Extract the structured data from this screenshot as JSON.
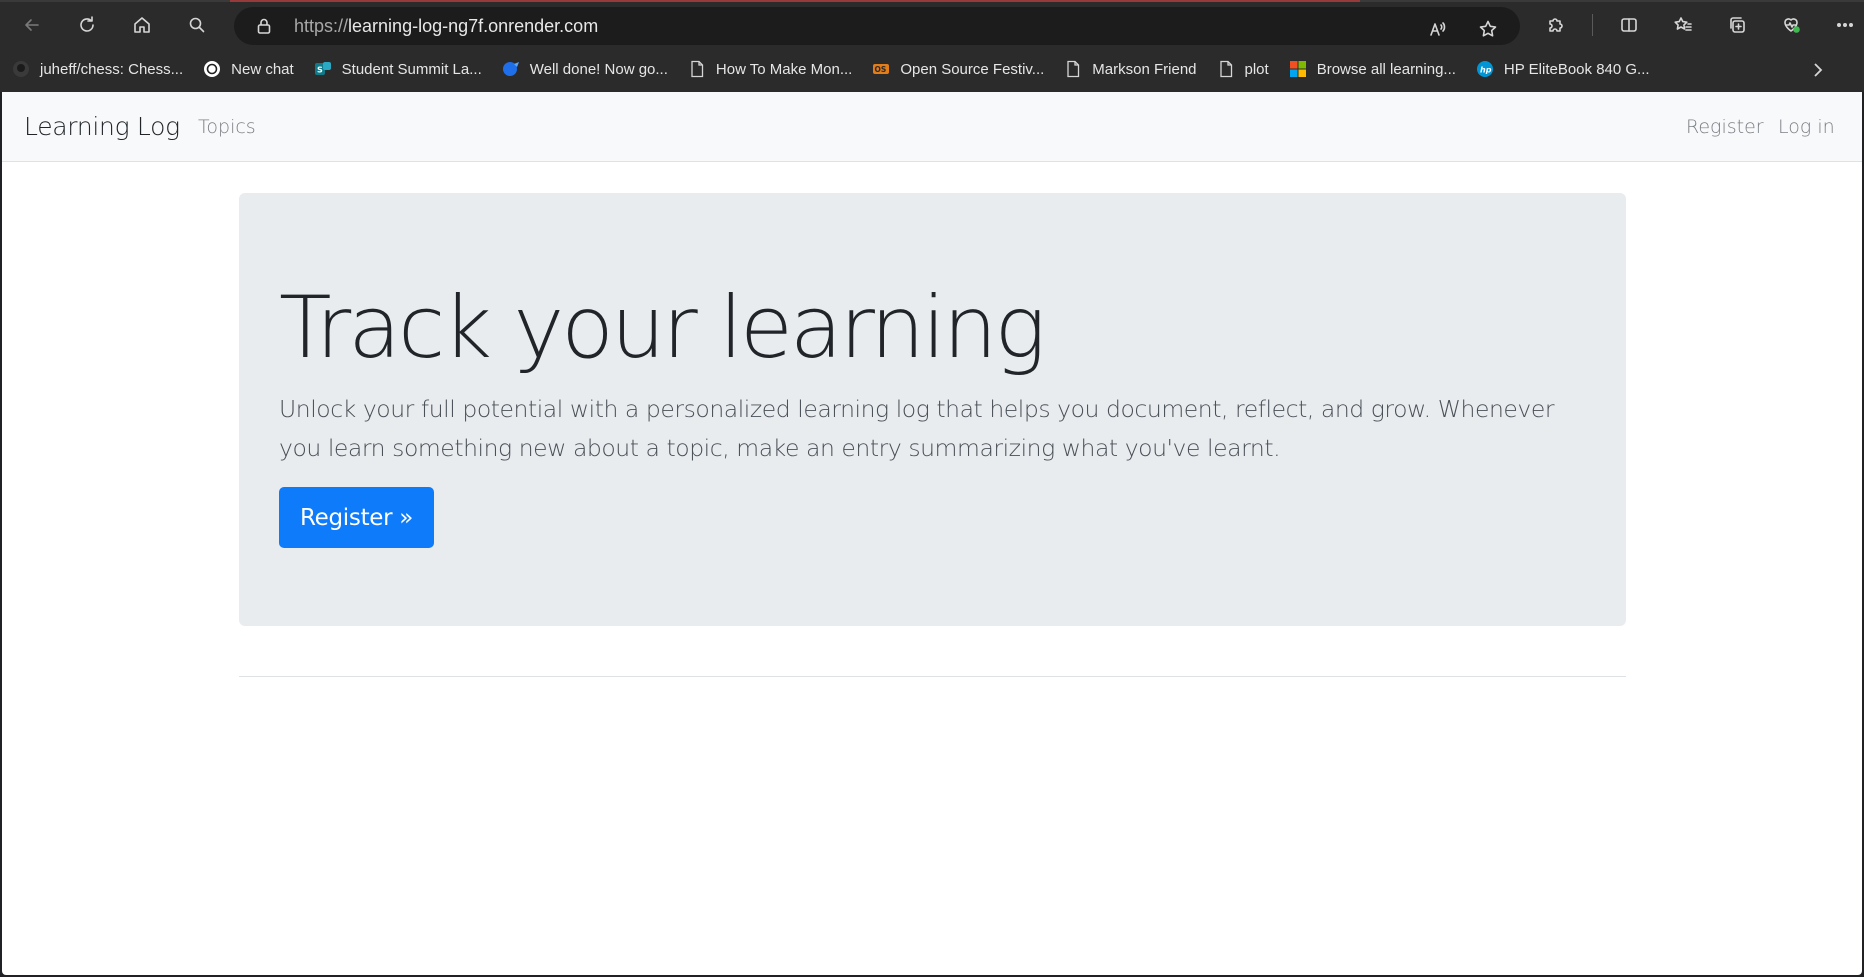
{
  "browser": {
    "url_protocol": "https://",
    "url_host": "learning-log-ng7f.onrender.com",
    "bookmarks": [
      {
        "label": "juheff/chess: Chess...",
        "icon": "github-icon"
      },
      {
        "label": "New chat",
        "icon": "openai-icon"
      },
      {
        "label": "Student Summit La...",
        "icon": "teams-icon"
      },
      {
        "label": "Well done! Now go...",
        "icon": "quiz-icon"
      },
      {
        "label": "How To Make Mon...",
        "icon": "page-icon"
      },
      {
        "label": "Open Source Festiv...",
        "icon": "osf-icon"
      },
      {
        "label": "Markson Friend",
        "icon": "page-icon"
      },
      {
        "label": "plot",
        "icon": "page-icon"
      },
      {
        "label": "Browse all learning...",
        "icon": "microsoft-icon"
      },
      {
        "label": "HP EliteBook 840 G...",
        "icon": "hp-icon"
      }
    ]
  },
  "navbar": {
    "brand": "Learning Log",
    "topics": "Topics",
    "register": "Register",
    "login": "Log in"
  },
  "hero": {
    "title": "Track your learning",
    "lead": "Unlock your full potential with a personalized learning log that helps you document, reflect, and grow. Whenever you learn something new about a topic, make an entry summarizing what you've learnt.",
    "button": "Register »"
  },
  "colors": {
    "primary": "#0d7bfa",
    "jumbotron_bg": "#e9ecef",
    "navbar_bg": "#f8f9fa"
  }
}
